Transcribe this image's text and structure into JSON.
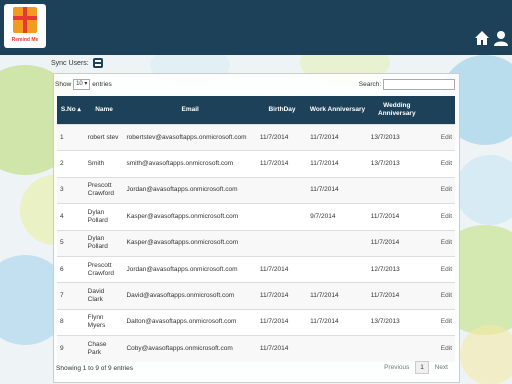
{
  "app": {
    "logo_text": "Remind Me",
    "accent_color": "#1d4159",
    "icons": [
      "home-icon",
      "user-icon"
    ]
  },
  "sync": {
    "label": "Sync Users:",
    "icon": "sync-icon"
  },
  "controls": {
    "show_label": "Show",
    "page_length": "10",
    "entries_label": "entries",
    "search_label": "Search:",
    "search_value": ""
  },
  "table": {
    "headers": {
      "no": "S.No",
      "name": "Name",
      "email": "Email",
      "birthday": "BirthDay",
      "work": "Work Anniversary",
      "wedding": "Wedding Anniversary"
    },
    "rows": [
      {
        "no": "1",
        "name": "robert stev",
        "email": "robertstev@avasoftapps.onmicrosoft.com",
        "birthday": "11/7/2014",
        "work": "11/7/2014",
        "wedding": "13/7/2013",
        "action": "Edit"
      },
      {
        "no": "2",
        "name": "Smith",
        "email": "smith@avasoftapps.onmicrosoft.com",
        "birthday": "11/7/2014",
        "work": "11/7/2014",
        "wedding": "13/7/2013",
        "action": "Edit"
      },
      {
        "no": "3",
        "name": "Prescott Crawford",
        "email": "Jordan@avasoftapps.onmicrosoft.com",
        "birthday": "",
        "work": "11/7/2014",
        "wedding": "",
        "action": "Edit"
      },
      {
        "no": "4",
        "name": "Dylan Pollard",
        "email": "Kasper@avasoftapps.onmicrosoft.com",
        "birthday": "",
        "work": "9/7/2014",
        "wedding": "11/7/2014",
        "action": "Edit"
      },
      {
        "no": "5",
        "name": "Dylan Pollard",
        "email": "Kasper@avasoftapps.onmicrosoft.com",
        "birthday": "",
        "work": "",
        "wedding": "11/7/2014",
        "action": "Edit"
      },
      {
        "no": "6",
        "name": "Prescott Crawford",
        "email": "Jordan@avasoftapps.onmicrosoft.com",
        "birthday": "11/7/2014",
        "work": "",
        "wedding": "12/7/2013",
        "action": "Edit"
      },
      {
        "no": "7",
        "name": "David Clark",
        "email": "David@avasoftapps.onmicrosoft.com",
        "birthday": "11/7/2014",
        "work": "11/7/2014",
        "wedding": "11/7/2014",
        "action": "Edit"
      },
      {
        "no": "8",
        "name": "Flynn Myers",
        "email": "Dalton@avasoftapps.onmicrosoft.com",
        "birthday": "11/7/2014",
        "work": "11/7/2014",
        "wedding": "13/7/2013",
        "action": "Edit"
      },
      {
        "no": "9",
        "name": "Chase Park",
        "email": "Coby@avasoftapps.onmicrosoft.com",
        "birthday": "11/7/2014",
        "work": "",
        "wedding": "",
        "action": "Edit"
      }
    ]
  },
  "footer": {
    "info": "Showing 1 to 9 of 9 entries",
    "prev": "Previous",
    "page": "1",
    "next": "Next"
  }
}
